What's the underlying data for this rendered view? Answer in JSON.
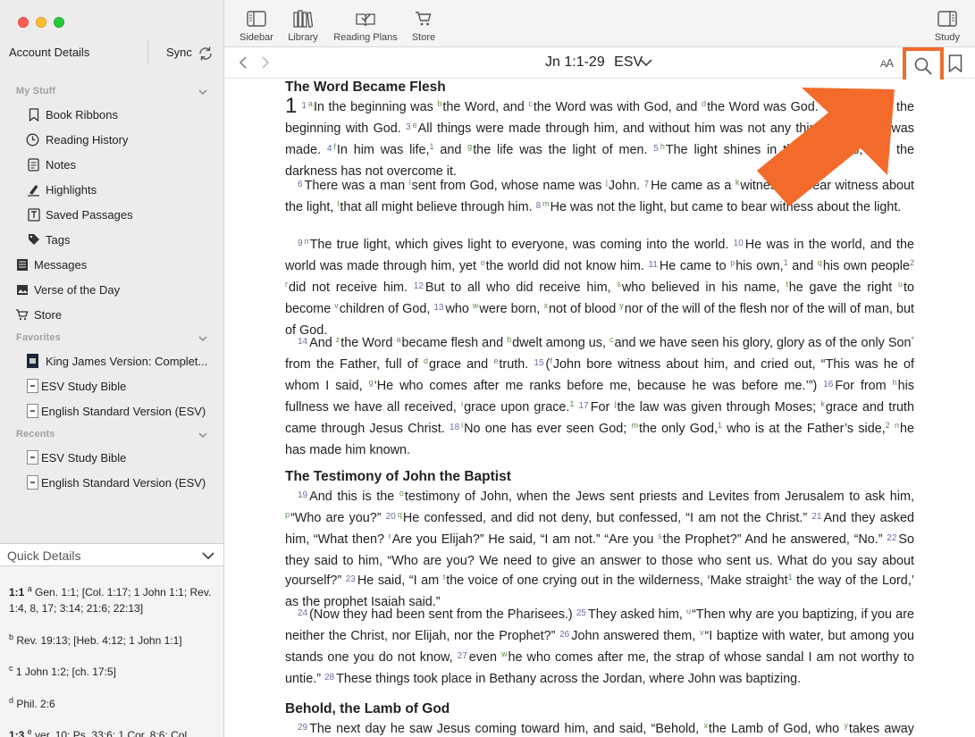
{
  "sidebar": {
    "account": "Account Details",
    "sync": "Sync",
    "my_stuff": "My Stuff",
    "items": [
      {
        "label": "Book Ribbons",
        "icon": "bookmark-icon"
      },
      {
        "label": "Reading History",
        "icon": "clock-icon"
      },
      {
        "label": "Notes",
        "icon": "note-icon"
      },
      {
        "label": "Highlights",
        "icon": "highlighter-icon"
      },
      {
        "label": "Saved Passages",
        "icon": "saved-passage-icon"
      },
      {
        "label": "Tags",
        "icon": "tag-icon"
      }
    ],
    "top_items": [
      {
        "label": "Messages",
        "icon": "messages-icon"
      },
      {
        "label": "Verse of the Day",
        "icon": "image-icon"
      },
      {
        "label": "Store",
        "icon": "cart-icon"
      }
    ],
    "favorites": "Favorites",
    "favorite_items": [
      {
        "label": "King James Version: Complet..."
      },
      {
        "label": "ESV Study Bible"
      },
      {
        "label": "English Standard Version (ESV)"
      }
    ],
    "recents": "Recents",
    "recent_items": [
      {
        "label": "ESV Study Bible"
      },
      {
        "label": "English Standard Version (ESV)"
      }
    ],
    "quick_details": {
      "title": "Quick Details",
      "entries": [
        {
          "ref": "1:1",
          "mark": "a",
          "text": "Gen. 1:1; [Col. 1:17; 1 John 1:1; Rev. 1:4, 8, 17; 3:14; 21:6; 22:13]"
        },
        {
          "ref": "",
          "mark": "b",
          "text": "Rev. 19:13; [Heb. 4:12; 1 John 1:1]"
        },
        {
          "ref": "",
          "mark": "c",
          "text": "1 John 1:2; [ch. 17:5]"
        },
        {
          "ref": "",
          "mark": "d",
          "text": "Phil. 2:6"
        },
        {
          "ref": "1:3",
          "mark": "e",
          "text": "ver. 10; Ps. 33:6; 1 Cor. 8:6; Col."
        }
      ]
    }
  },
  "toolbar": {
    "sidebar": "Sidebar",
    "library": "Library",
    "reading_plans": "Reading Plans",
    "store": "Store",
    "study": "Study"
  },
  "navbar": {
    "reference": "Jn 1:1-29",
    "version": "ESV",
    "font_small": "A",
    "font_large": "A"
  },
  "reader": {
    "heading1": "The Word Became Flesh",
    "heading2": "The Testimony of John the Baptist",
    "heading3": "Behold, the Lamb of God",
    "chapter": "1"
  }
}
